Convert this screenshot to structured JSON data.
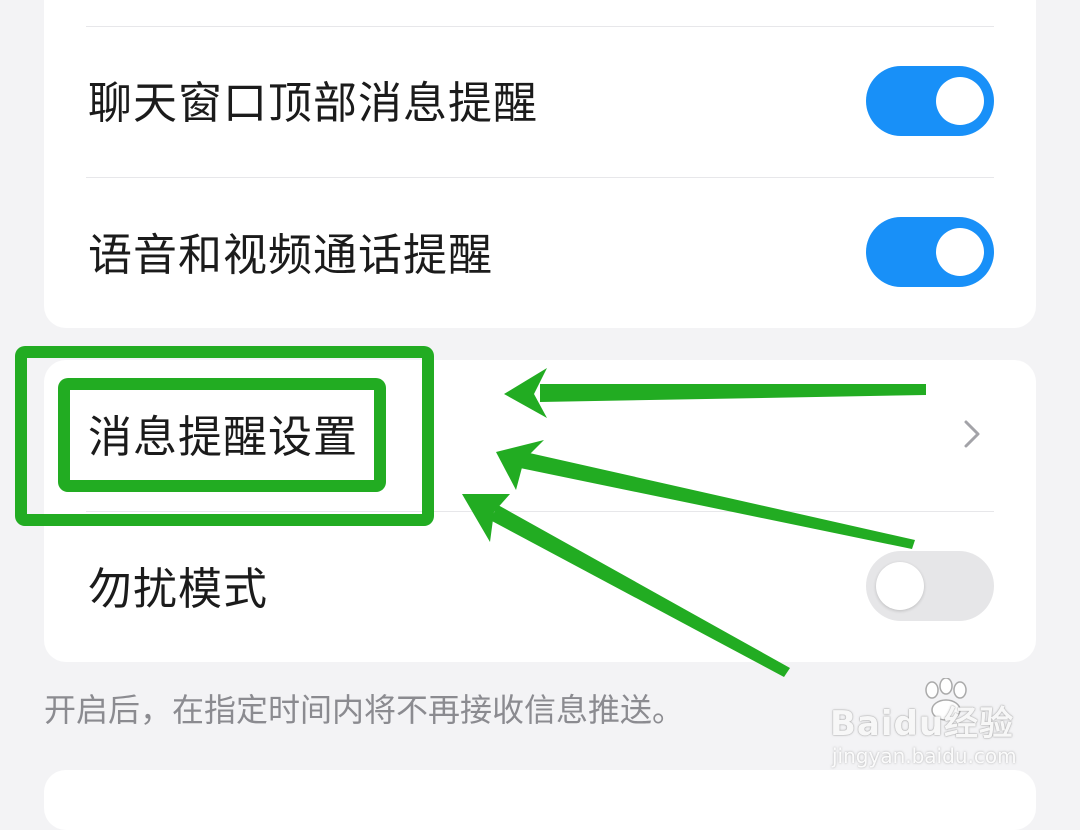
{
  "settings": {
    "chat_top_alert": {
      "label": "聊天窗口顶部消息提醒",
      "enabled": true
    },
    "call_alert": {
      "label": "语音和视频通话提醒",
      "enabled": true
    },
    "notification_settings": {
      "label": "消息提醒设置"
    },
    "do_not_disturb": {
      "label": "勿扰模式",
      "enabled": false
    }
  },
  "note": "开启后，在指定时间内将不再接收信息推送。",
  "watermark": {
    "main": "Baidu经验",
    "sub": "jingyan.baidu.com"
  },
  "annotation": {
    "color": "#22ac22",
    "toggle_on_color": "#1890f8"
  }
}
